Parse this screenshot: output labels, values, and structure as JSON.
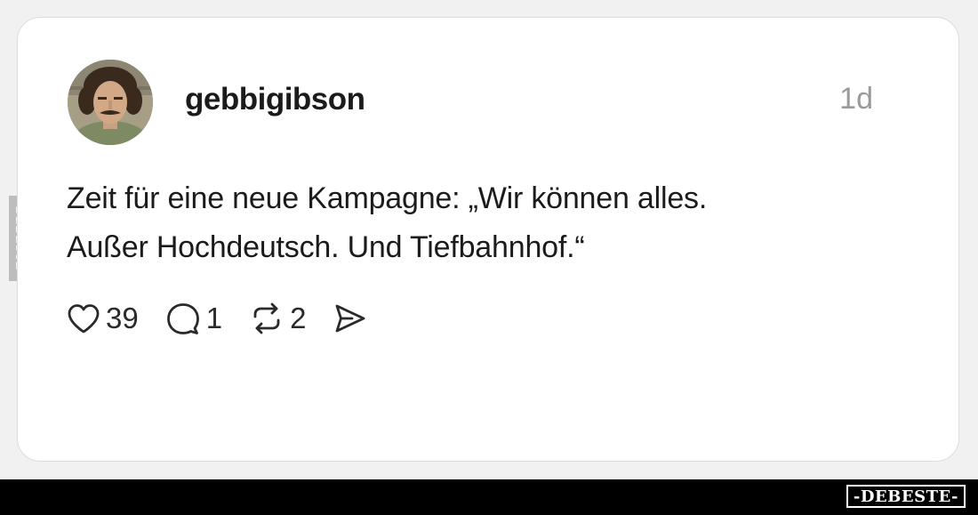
{
  "post": {
    "username": "gebbigibson",
    "timestamp": "1d",
    "text_lines": [
      "Zeit für eine neue Kampagne: „Wir können alles.",
      "Außer Hochdeutsch. Und Tiefbahnhof.“"
    ],
    "likes": "39",
    "replies": "1",
    "reposts": "2"
  },
  "icons": {
    "like": "heart-icon",
    "reply": "comment-bubble-icon",
    "repost": "repost-icon",
    "share": "send-icon"
  },
  "watermark": {
    "side_label": "DEBESTE",
    "footer_label": "-DEBESTE-"
  },
  "colors": {
    "text": "#1b1b1b",
    "muted": "#9a9a9a",
    "card": "#ffffff",
    "background": "#f1f1f1",
    "footer": "#000000"
  }
}
